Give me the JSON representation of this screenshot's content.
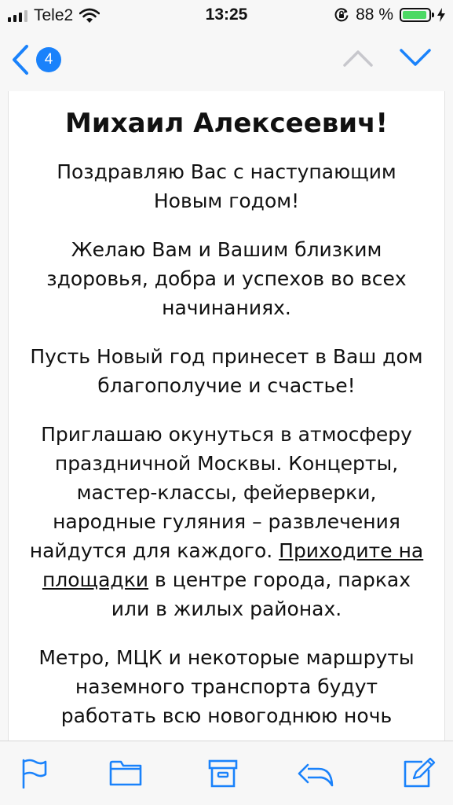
{
  "status_bar": {
    "carrier": "Tele2",
    "time": "13:25",
    "battery_percent": "88 %",
    "battery_level": 0.88,
    "charging": true,
    "icons": [
      "signal-icon",
      "wifi-icon",
      "orientation-lock-icon",
      "battery-icon",
      "charging-bolt-icon"
    ]
  },
  "nav": {
    "unread_count": "4",
    "icons": [
      "back-chevron-icon",
      "chevron-up-icon",
      "chevron-down-icon"
    ]
  },
  "message": {
    "greeting": "Михаил Алексеевич!",
    "p1": "Поздравляю Вас с наступающим Новым годом!",
    "p2": "Желаю Вам и Вашим близким здоровья, добра и успехов во всех начинаниях.",
    "p3": "Пусть Новый год принесет в Ваш дом благополучие и счастье!",
    "p4_before_link": "Приглашаю окунуться в атмосферу праздничной Москвы. Концерты, мастер-классы, фейерверки, народные гуляния – развлечения найдутся для каждого. ",
    "p4_link": "Приходите на площадки",
    "p4_after_link": " в центре города, парках или в жилых районах.",
    "p5": "Метро, МЦК и некоторые маршруты наземного транспорта будут работать всю новогоднюю ночь"
  },
  "toolbar": {
    "icons": [
      "flag-icon",
      "folder-icon",
      "archive-icon",
      "reply-icon",
      "compose-icon"
    ]
  },
  "colors": {
    "accent": "#1a82fb",
    "battery_green": "#4cd964",
    "disabled": "#c7c7cc"
  }
}
